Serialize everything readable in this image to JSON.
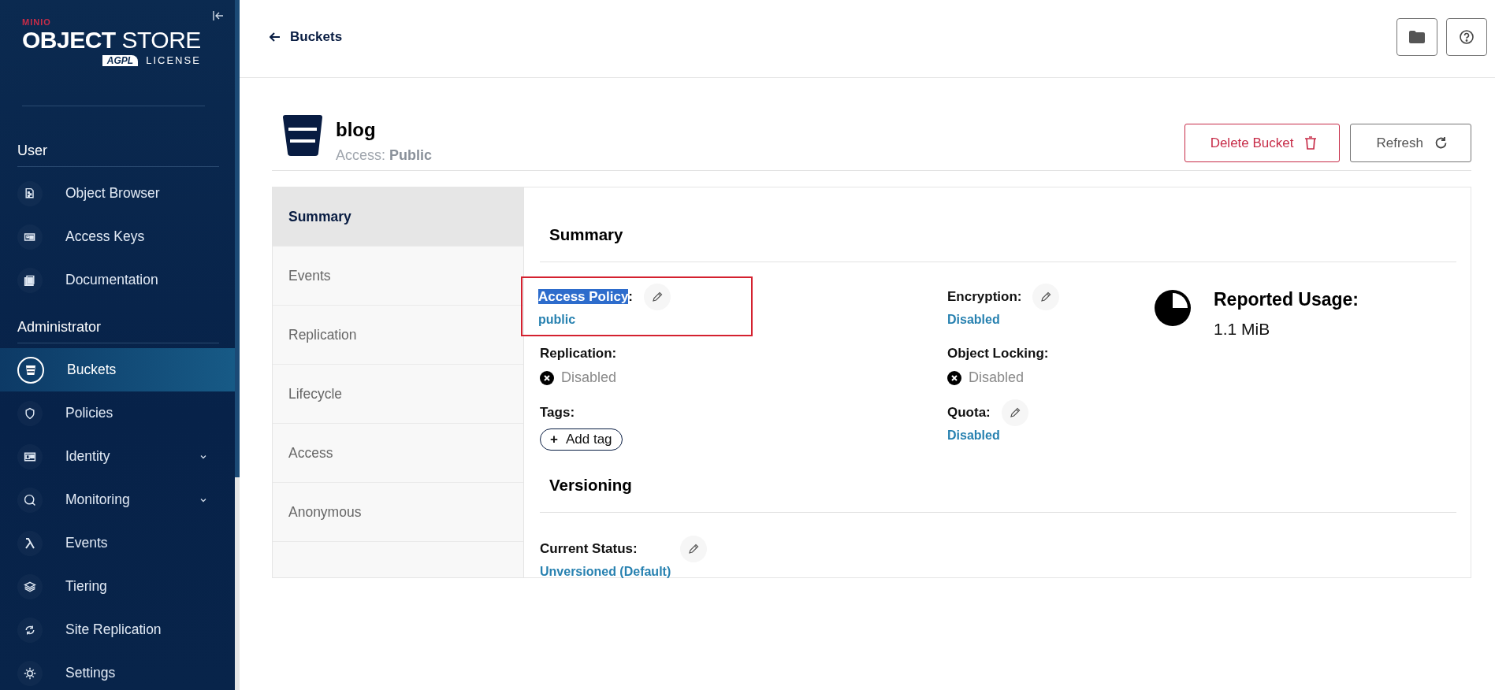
{
  "logo": {
    "brand": "MINIO",
    "title_bold": "OBJECT",
    "title_light": "STORE",
    "badge": "AGPL",
    "license": "LICENSE"
  },
  "sidebar": {
    "sections": [
      {
        "title": "User",
        "items": [
          {
            "label": "Object Browser",
            "selected": false,
            "expandable": false
          },
          {
            "label": "Access Keys",
            "selected": false,
            "expandable": false
          },
          {
            "label": "Documentation",
            "selected": false,
            "expandable": false
          }
        ]
      },
      {
        "title": "Administrator",
        "items": [
          {
            "label": "Buckets",
            "selected": true,
            "expandable": false
          },
          {
            "label": "Policies",
            "selected": false,
            "expandable": false
          },
          {
            "label": "Identity",
            "selected": false,
            "expandable": true
          },
          {
            "label": "Monitoring",
            "selected": false,
            "expandable": true
          },
          {
            "label": "Events",
            "selected": false,
            "expandable": false
          },
          {
            "label": "Tiering",
            "selected": false,
            "expandable": false
          },
          {
            "label": "Site Replication",
            "selected": false,
            "expandable": false
          },
          {
            "label": "Settings",
            "selected": false,
            "expandable": false
          }
        ]
      }
    ]
  },
  "header": {
    "back_label": "Buckets"
  },
  "bucket": {
    "name": "blog",
    "access_label": "Access:",
    "access_value": "Public"
  },
  "actions": [
    {
      "label": "Delete Bucket",
      "kind": "danger"
    },
    {
      "label": "Refresh",
      "kind": "default"
    }
  ],
  "tabs": [
    {
      "label": "Summary",
      "selected": true
    },
    {
      "label": "Events",
      "selected": false
    },
    {
      "label": "Replication",
      "selected": false
    },
    {
      "label": "Lifecycle",
      "selected": false
    },
    {
      "label": "Access",
      "selected": false
    },
    {
      "label": "Anonymous",
      "selected": false
    }
  ],
  "summary": {
    "title": "Summary",
    "columns": [
      [
        {
          "label": "Access Policy",
          "label_suffix": ":",
          "label_selected": true,
          "annotated": true,
          "editable": true,
          "kind": "link",
          "value": "public"
        },
        {
          "label": "Replication:",
          "editable": false,
          "kind": "status",
          "value": "Disabled"
        },
        {
          "label": "Tags:",
          "editable": false,
          "kind": "tags",
          "icon_text": "+",
          "value": "Add tag"
        }
      ],
      [
        {
          "label": "Encryption:",
          "editable": true,
          "kind": "link",
          "value": "Disabled"
        },
        {
          "label": "Object Locking:",
          "editable": false,
          "kind": "status",
          "value": "Disabled"
        },
        {
          "label": "Quota:",
          "editable": true,
          "kind": "link",
          "value": "Disabled"
        }
      ]
    ],
    "usage": {
      "label": "Reported Usage:",
      "value": "1.1 MiB"
    }
  },
  "versioning": {
    "title": "Versioning",
    "fields": [
      {
        "label": "Current Status:",
        "editable": true,
        "kind": "link",
        "value": "Unversioned (Default)"
      }
    ]
  }
}
